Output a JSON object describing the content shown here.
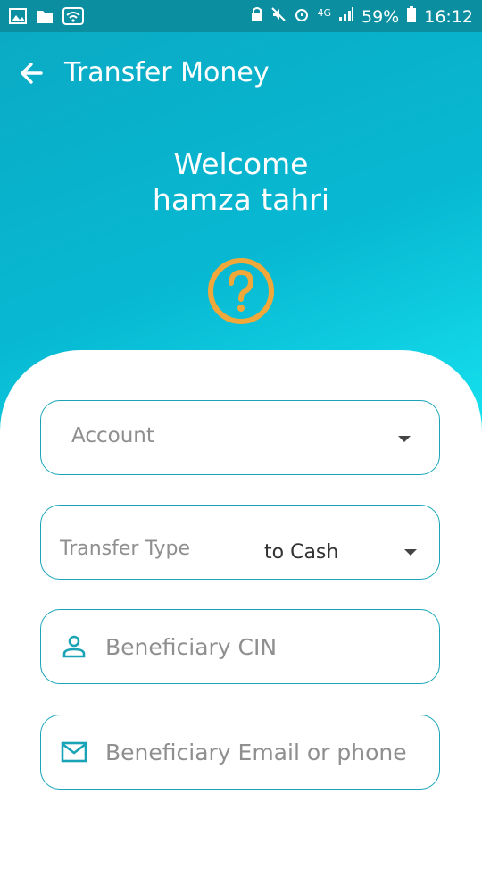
{
  "status_bar": {
    "network": "4G",
    "battery": "59%",
    "time": "16:12"
  },
  "toolbar": {
    "title": "Transfer Money"
  },
  "welcome": {
    "line1": "Welcome",
    "line2": "hamza tahri"
  },
  "form": {
    "account": {
      "placeholder": "Account"
    },
    "transfer_type": {
      "label": "Transfer Type",
      "value": "to Cash"
    },
    "beneficiary_cin": {
      "placeholder": "Beneficiary CIN"
    },
    "beneficiary_contact": {
      "placeholder": "Beneficiary Email or phone"
    }
  },
  "colors": {
    "status_bar": "#0b8fa0",
    "header_start": "#0aaac4",
    "header_end": "#16e3f0",
    "field_border": "#18a5b8",
    "help_icon": "#f0a83a",
    "icon_teal": "#19a3b6"
  },
  "icons": [
    "image-icon",
    "folder-icon",
    "wifi-icon",
    "back-arrow-icon",
    "help-icon",
    "chevron-down-icon",
    "person-icon",
    "mail-icon"
  ]
}
